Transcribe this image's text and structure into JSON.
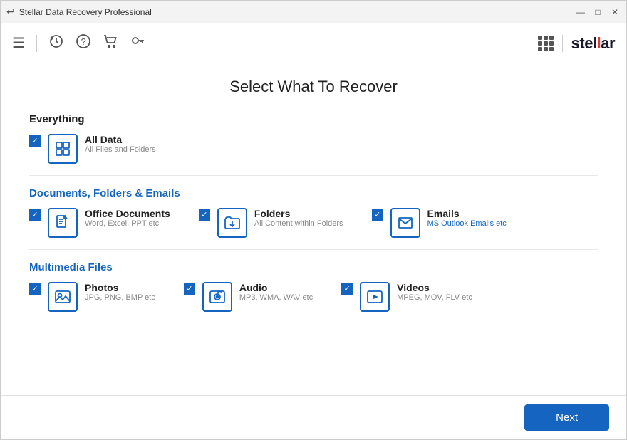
{
  "titlebar": {
    "title": "Stellar Data Recovery Professional",
    "back_icon": "↩",
    "min_label": "—",
    "max_label": "□",
    "close_label": "✕"
  },
  "toolbar": {
    "menu_icon": "≡",
    "history_icon": "◷",
    "help_icon": "?",
    "cart_icon": "🛒",
    "key_icon": "🔑",
    "divider": "|",
    "logo_text_1": "stel",
    "logo_text_accent": "l",
    "logo_text_2": "ar"
  },
  "page": {
    "title": "Select What To Recover"
  },
  "sections": [
    {
      "id": "everything",
      "title": "Everything",
      "title_color": "black",
      "options": [
        {
          "id": "all-data",
          "label": "All Data",
          "sublabel": "All Files and Folders",
          "sublabel_color": "gray",
          "checked": true,
          "icon": "all-data"
        }
      ]
    },
    {
      "id": "documents",
      "title": "Documents, Folders & Emails",
      "title_color": "blue",
      "options": [
        {
          "id": "office",
          "label": "Office Documents",
          "sublabel": "Word, Excel, PPT etc",
          "sublabel_color": "gray",
          "checked": true,
          "icon": "document"
        },
        {
          "id": "folders",
          "label": "Folders",
          "sublabel": "All Content within Folders",
          "sublabel_color": "gray",
          "checked": true,
          "icon": "folder"
        },
        {
          "id": "emails",
          "label": "Emails",
          "sublabel": "MS Outlook Emails etc",
          "sublabel_color": "blue",
          "checked": true,
          "icon": "email"
        }
      ]
    },
    {
      "id": "multimedia",
      "title": "Multimedia Files",
      "title_color": "blue",
      "options": [
        {
          "id": "photos",
          "label": "Photos",
          "sublabel": "JPG, PNG, BMP etc",
          "sublabel_color": "gray",
          "checked": true,
          "icon": "photo"
        },
        {
          "id": "audio",
          "label": "Audio",
          "sublabel": "MP3, WMA, WAV etc",
          "sublabel_color": "gray",
          "checked": true,
          "icon": "audio"
        },
        {
          "id": "videos",
          "label": "Videos",
          "sublabel": "MPEG, MOV, FLV etc",
          "sublabel_color": "gray",
          "checked": true,
          "icon": "video"
        }
      ]
    }
  ],
  "footer": {
    "next_label": "Next"
  }
}
